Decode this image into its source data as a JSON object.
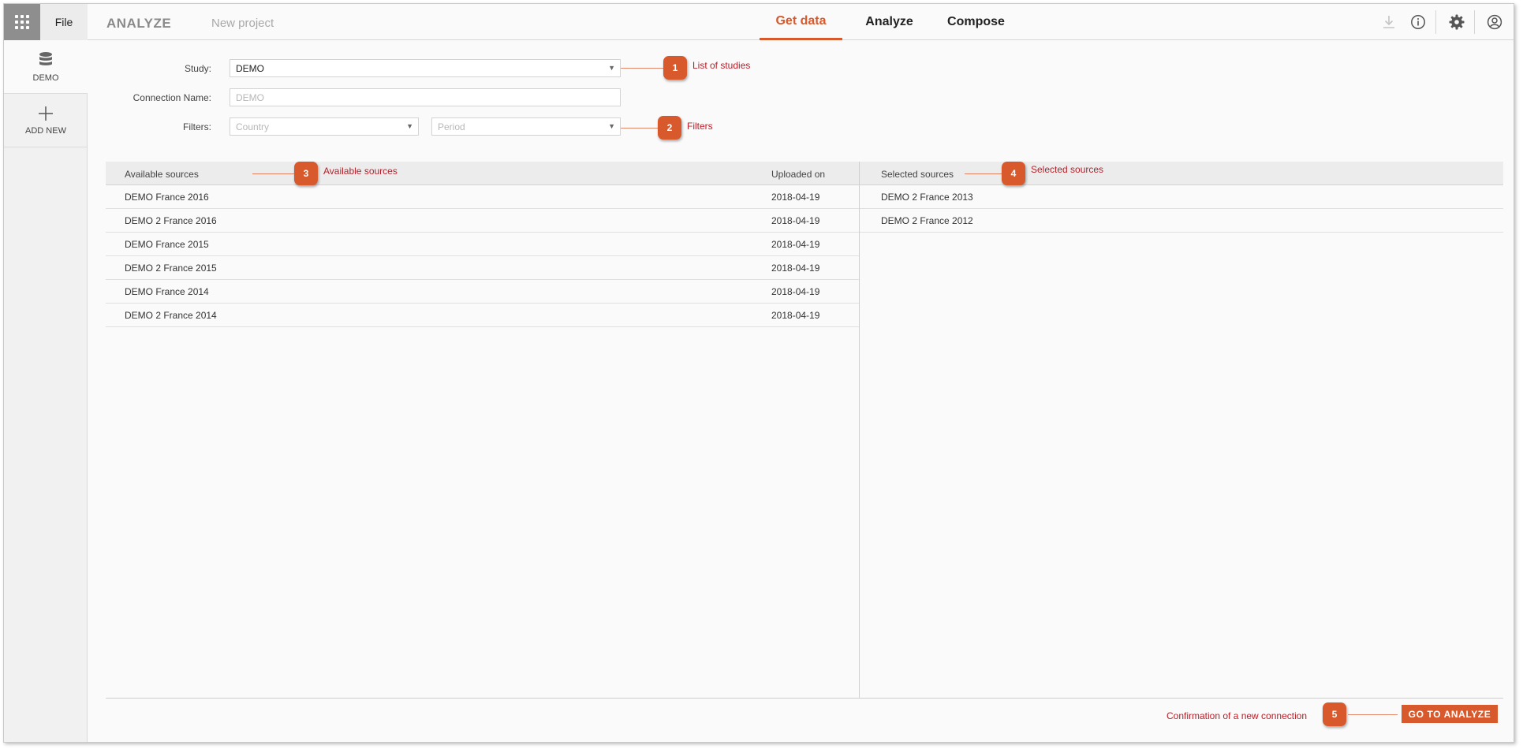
{
  "header": {
    "file_label": "File",
    "app_title": "ANALYZE",
    "project_name": "New project",
    "tabs": [
      {
        "label": "Get data",
        "active": true
      },
      {
        "label": "Analyze",
        "active": false
      },
      {
        "label": "Compose",
        "active": false
      }
    ],
    "icons": [
      "download-icon",
      "info-icon",
      "gear-icon",
      "user-icon"
    ]
  },
  "sidebar": {
    "items": [
      {
        "label": "DEMO",
        "icon": "database-icon",
        "active": true
      },
      {
        "label": "ADD NEW",
        "icon": "plus-icon",
        "active": false
      }
    ]
  },
  "form": {
    "study_label": "Study:",
    "study_value": "DEMO",
    "connection_label": "Connection Name:",
    "connection_placeholder": "DEMO",
    "filters_label": "Filters:",
    "country_placeholder": "Country",
    "period_placeholder": "Period"
  },
  "callouts": [
    {
      "number": "1",
      "text": "List of studies"
    },
    {
      "number": "2",
      "text": "Filters"
    },
    {
      "number": "3",
      "text": "Available sources"
    },
    {
      "number": "4",
      "text": "Selected sources"
    },
    {
      "number": "5",
      "text": "Confirmation of a new connection"
    }
  ],
  "available": {
    "header_name": "Available sources",
    "header_date": "Uploaded on",
    "rows": [
      {
        "name": "DEMO France 2016",
        "date": "2018-04-19"
      },
      {
        "name": "DEMO 2 France 2016",
        "date": "2018-04-19"
      },
      {
        "name": "DEMO France 2015",
        "date": "2018-04-19"
      },
      {
        "name": "DEMO 2 France 2015",
        "date": "2018-04-19"
      },
      {
        "name": "DEMO France 2014",
        "date": "2018-04-19"
      },
      {
        "name": "DEMO 2 France 2014",
        "date": "2018-04-19"
      }
    ]
  },
  "selected": {
    "header_name": "Selected sources",
    "rows": [
      {
        "name": "DEMO 2 France 2013"
      },
      {
        "name": "DEMO 2 France 2012"
      }
    ]
  },
  "actions": {
    "go_label": "GO TO ANALYZE"
  },
  "colors": {
    "accent": "#d8592c",
    "callout_text": "#b8202a"
  }
}
